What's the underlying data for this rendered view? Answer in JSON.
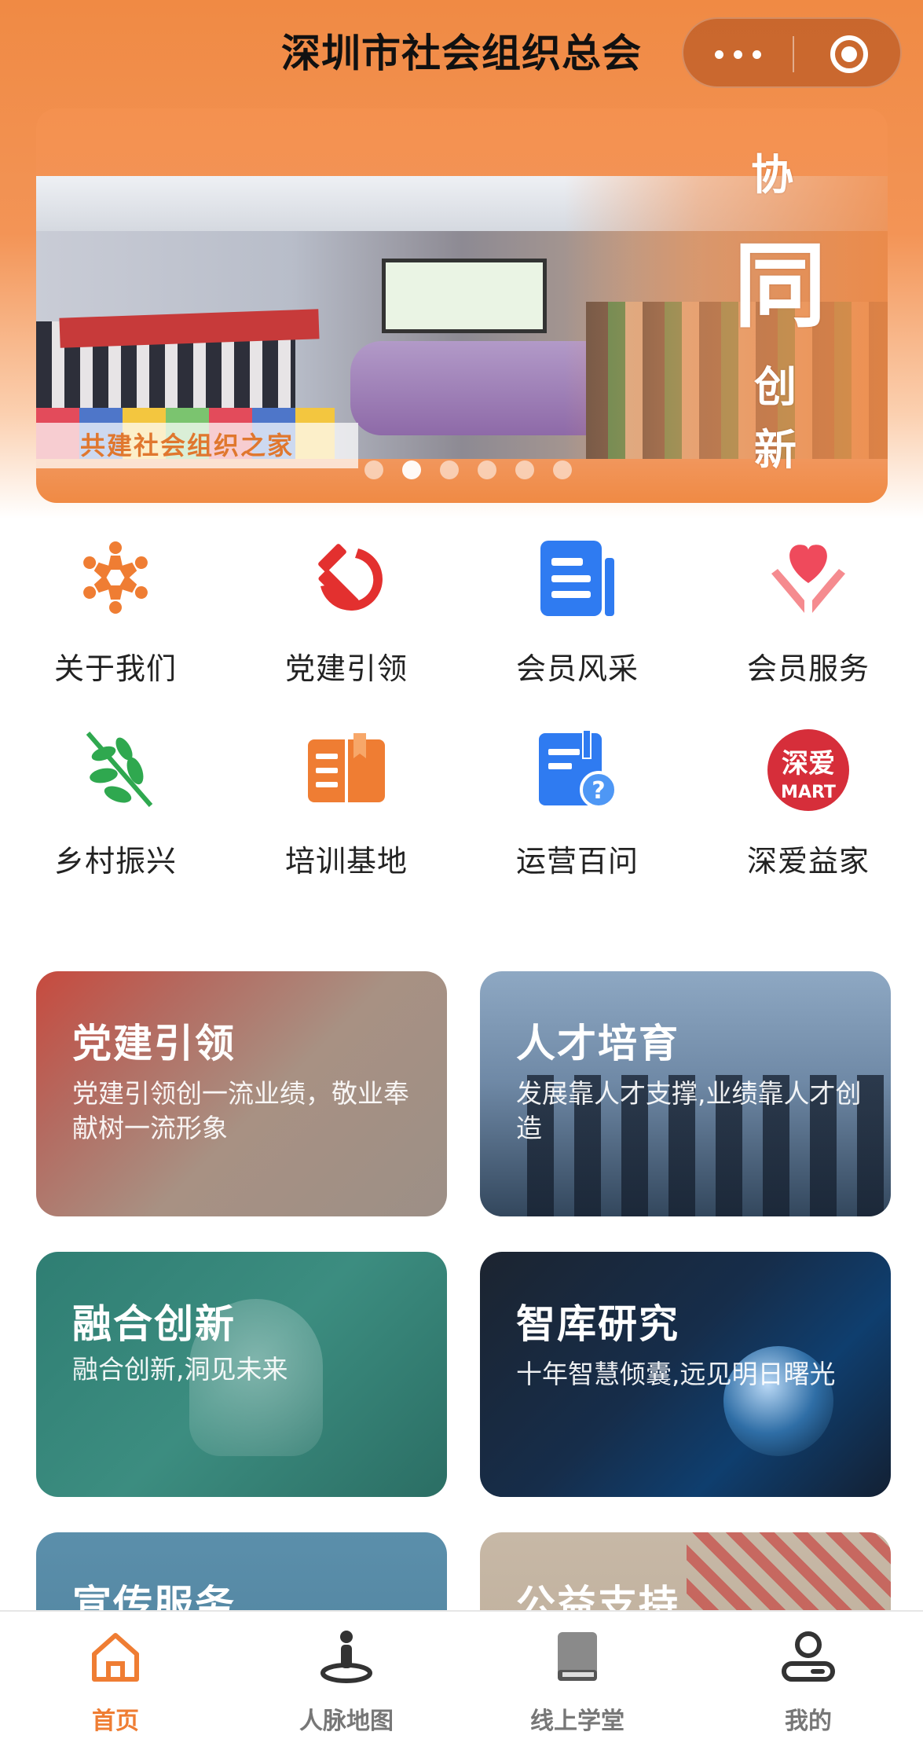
{
  "app": {
    "title": "深圳市社会组织总会"
  },
  "capsule": {
    "more_icon": "more-dots-icon",
    "close_icon": "target-circle-icon"
  },
  "banner": {
    "slogan": "共建社会组织之家",
    "side_text": [
      "协",
      "同",
      "创",
      "新"
    ],
    "dots_total": 6,
    "active_dot": 2
  },
  "menu": [
    {
      "label": "关于我们",
      "icon": "people-circle-icon"
    },
    {
      "label": "党建引领",
      "icon": "hammer-sickle-icon"
    },
    {
      "label": "会员风采",
      "icon": "news-document-icon"
    },
    {
      "label": "会员服务",
      "icon": "heart-hands-icon"
    },
    {
      "label": "乡村振兴",
      "icon": "wheat-leaf-icon"
    },
    {
      "label": "培训基地",
      "icon": "open-book-icon"
    },
    {
      "label": "运营百问",
      "icon": "book-question-icon"
    },
    {
      "label": "深爱益家",
      "icon": "shenai-mart-logo",
      "logo_text": [
        "深爱",
        "MART"
      ]
    }
  ],
  "cards": [
    {
      "title": "党建引领",
      "subtitle": "党建引领创一流业绩，敬业奉献树一流形象"
    },
    {
      "title": "人才培育",
      "subtitle": "发展靠人才支撑,业绩靠人才创造"
    },
    {
      "title": "融合创新",
      "subtitle": "融合创新,洞见未来"
    },
    {
      "title": "智库研究",
      "subtitle": "十年智慧倾囊,远见明日曙光"
    },
    {
      "title": "宣传服务",
      "subtitle": ""
    },
    {
      "title": "公益支持",
      "subtitle": ""
    }
  ],
  "tabs": [
    {
      "label": "首页",
      "icon": "home-icon",
      "active": true
    },
    {
      "label": "人脉地图",
      "icon": "person-map-pin-icon",
      "active": false
    },
    {
      "label": "线上学堂",
      "icon": "book-icon",
      "active": false
    },
    {
      "label": "我的",
      "icon": "user-profile-icon",
      "active": false
    }
  ],
  "colors": {
    "accent": "#ef7d33",
    "header": "#f08a44"
  }
}
